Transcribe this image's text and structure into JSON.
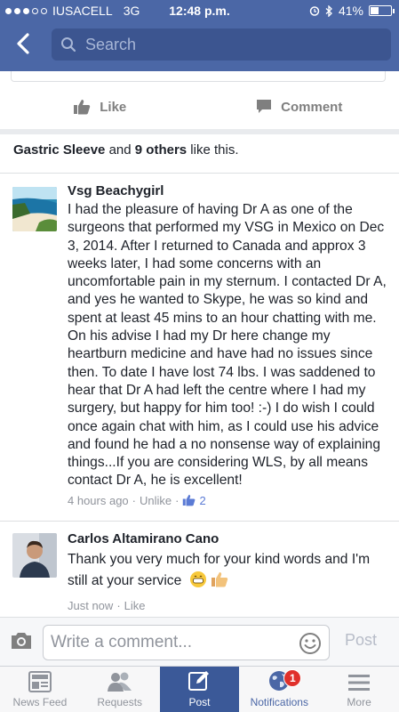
{
  "status_bar": {
    "carrier": "IUSACELL",
    "network": "3G",
    "time": "12:48 p.m.",
    "battery": "41%",
    "battery_level": 0.41
  },
  "nav": {
    "search_placeholder": "Search"
  },
  "post_actions": {
    "like_label": "Like",
    "comment_label": "Comment"
  },
  "likes_summary": {
    "name": "Gastric Sleeve",
    "and": " and ",
    "others": "9 others",
    "suffix": " like this."
  },
  "comments": [
    {
      "author": "Vsg Beachygirl",
      "text": "I had the pleasure of having Dr A as one of the surgeons that performed my VSG in Mexico on Dec 3, 2014. After I returned to Canada and approx 3 weeks later, I had some concerns with an uncomfortable pain in my sternum. I contacted Dr A, and yes he wanted to Skype, he was so kind and spent at least 45 mins to an hour chatting with me. On his advise I had my Dr here change my heartburn medicine and have had no issues since then. To date I have lost 74 lbs. I was saddened to hear that Dr A had left the centre where I had my surgery, but happy for him too! :-) I do wish I could once again chat with him, as I could use his advice and found he had a no nonsense way of explaining things...If you are considering WLS, by all means contact Dr A, he is excellent!",
      "time": "4 hours ago",
      "action": "Unlike",
      "like_count": "2"
    },
    {
      "author": "Carlos Altamirano Cano",
      "text": "Thank you very much for your kind words and I'm still at your service",
      "time": "Just now",
      "action": "Like"
    }
  ],
  "composer": {
    "placeholder": "Write a comment...",
    "post_label": "Post"
  },
  "tabs": [
    {
      "label": "News Feed",
      "icon": "news-feed-icon"
    },
    {
      "label": "Requests",
      "icon": "friends-icon"
    },
    {
      "label": "Post",
      "icon": "compose-icon"
    },
    {
      "label": "Notifications",
      "icon": "globe-icon",
      "badge": "1"
    },
    {
      "label": "More",
      "icon": "menu-icon"
    }
  ],
  "colors": {
    "brand": "#4b67a6",
    "active_tab": "#3b5998",
    "badge": "#e0302b",
    "link": "#4b67a6"
  }
}
